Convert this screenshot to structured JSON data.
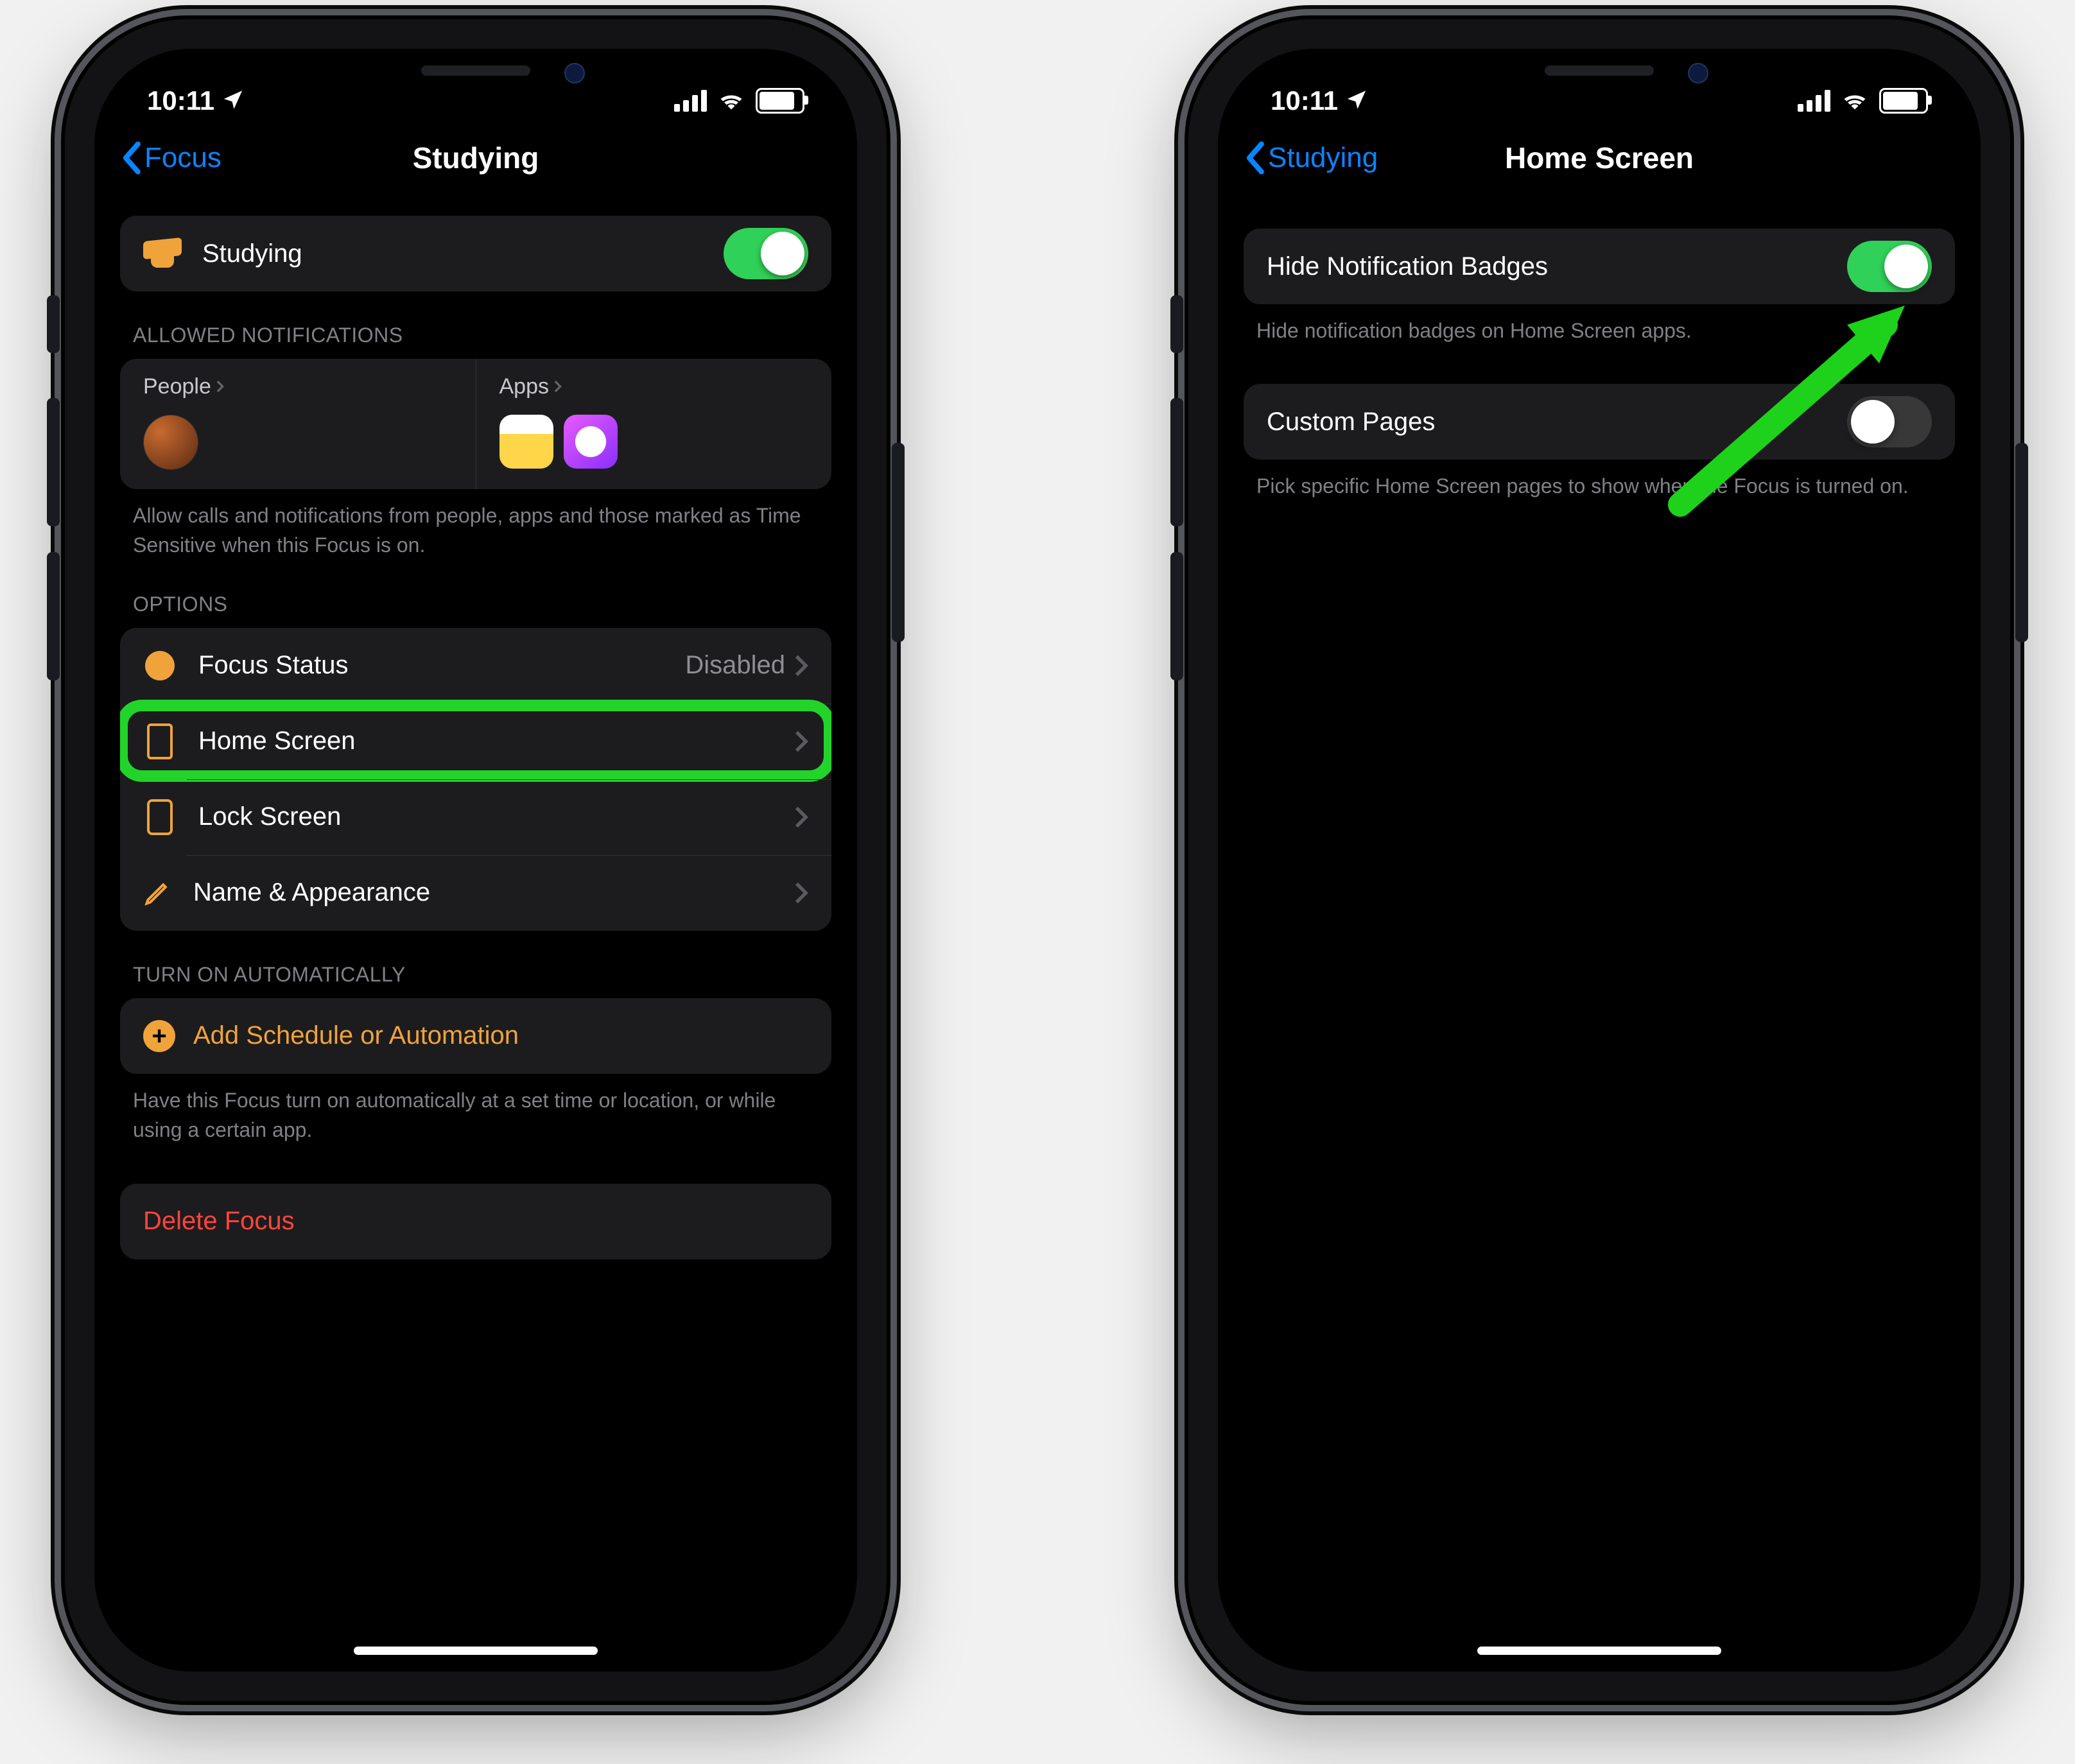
{
  "status": {
    "time": "10:11"
  },
  "screen1": {
    "nav": {
      "back": "Focus",
      "title": "Studying"
    },
    "focusCell": {
      "label": "Studying"
    },
    "allowed": {
      "header": "ALLOWED NOTIFICATIONS",
      "peopleLabel": "People",
      "appsLabel": "Apps",
      "footer": "Allow calls and notifications from people, apps and those marked as Time Sensitive when this Focus is on."
    },
    "options": {
      "header": "OPTIONS",
      "focusStatus": {
        "label": "Focus Status",
        "value": "Disabled"
      },
      "homeScreen": {
        "label": "Home Screen"
      },
      "lockScreen": {
        "label": "Lock Screen"
      },
      "nameAppearance": {
        "label": "Name & Appearance"
      }
    },
    "auto": {
      "header": "TURN ON AUTOMATICALLY",
      "addLabel": "Add Schedule or Automation",
      "footer": "Have this Focus turn on automatically at a set time or location, or while using a certain app."
    },
    "deleteLabel": "Delete Focus"
  },
  "screen2": {
    "nav": {
      "back": "Studying",
      "title": "Home Screen"
    },
    "hideBadges": {
      "label": "Hide Notification Badges",
      "footer": "Hide notification badges on Home Screen apps."
    },
    "customPages": {
      "label": "Custom Pages",
      "footer": "Pick specific Home Screen pages to show when the Focus is turned on."
    }
  }
}
